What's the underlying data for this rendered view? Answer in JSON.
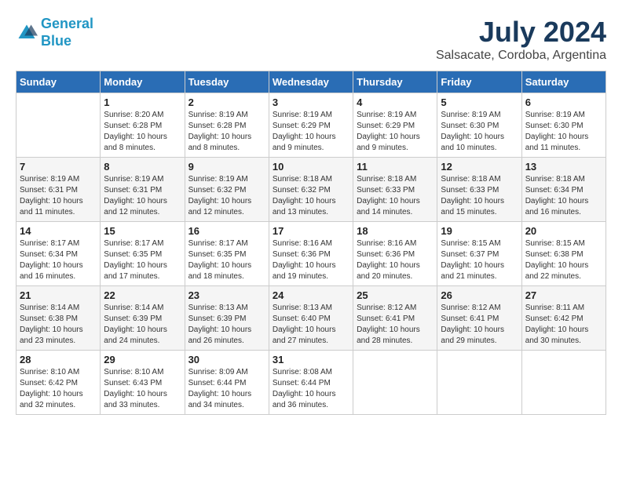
{
  "header": {
    "logo_line1": "General",
    "logo_line2": "Blue",
    "month_year": "July 2024",
    "location": "Salsacate, Cordoba, Argentina"
  },
  "weekdays": [
    "Sunday",
    "Monday",
    "Tuesday",
    "Wednesday",
    "Thursday",
    "Friday",
    "Saturday"
  ],
  "weeks": [
    [
      {
        "day": null,
        "info": null
      },
      {
        "day": "1",
        "info": "Sunrise: 8:20 AM\nSunset: 6:28 PM\nDaylight: 10 hours\nand 8 minutes."
      },
      {
        "day": "2",
        "info": "Sunrise: 8:19 AM\nSunset: 6:28 PM\nDaylight: 10 hours\nand 8 minutes."
      },
      {
        "day": "3",
        "info": "Sunrise: 8:19 AM\nSunset: 6:29 PM\nDaylight: 10 hours\nand 9 minutes."
      },
      {
        "day": "4",
        "info": "Sunrise: 8:19 AM\nSunset: 6:29 PM\nDaylight: 10 hours\nand 9 minutes."
      },
      {
        "day": "5",
        "info": "Sunrise: 8:19 AM\nSunset: 6:30 PM\nDaylight: 10 hours\nand 10 minutes."
      },
      {
        "day": "6",
        "info": "Sunrise: 8:19 AM\nSunset: 6:30 PM\nDaylight: 10 hours\nand 11 minutes."
      }
    ],
    [
      {
        "day": "7",
        "info": "Sunrise: 8:19 AM\nSunset: 6:31 PM\nDaylight: 10 hours\nand 11 minutes."
      },
      {
        "day": "8",
        "info": "Sunrise: 8:19 AM\nSunset: 6:31 PM\nDaylight: 10 hours\nand 12 minutes."
      },
      {
        "day": "9",
        "info": "Sunrise: 8:19 AM\nSunset: 6:32 PM\nDaylight: 10 hours\nand 12 minutes."
      },
      {
        "day": "10",
        "info": "Sunrise: 8:18 AM\nSunset: 6:32 PM\nDaylight: 10 hours\nand 13 minutes."
      },
      {
        "day": "11",
        "info": "Sunrise: 8:18 AM\nSunset: 6:33 PM\nDaylight: 10 hours\nand 14 minutes."
      },
      {
        "day": "12",
        "info": "Sunrise: 8:18 AM\nSunset: 6:33 PM\nDaylight: 10 hours\nand 15 minutes."
      },
      {
        "day": "13",
        "info": "Sunrise: 8:18 AM\nSunset: 6:34 PM\nDaylight: 10 hours\nand 16 minutes."
      }
    ],
    [
      {
        "day": "14",
        "info": "Sunrise: 8:17 AM\nSunset: 6:34 PM\nDaylight: 10 hours\nand 16 minutes."
      },
      {
        "day": "15",
        "info": "Sunrise: 8:17 AM\nSunset: 6:35 PM\nDaylight: 10 hours\nand 17 minutes."
      },
      {
        "day": "16",
        "info": "Sunrise: 8:17 AM\nSunset: 6:35 PM\nDaylight: 10 hours\nand 18 minutes."
      },
      {
        "day": "17",
        "info": "Sunrise: 8:16 AM\nSunset: 6:36 PM\nDaylight: 10 hours\nand 19 minutes."
      },
      {
        "day": "18",
        "info": "Sunrise: 8:16 AM\nSunset: 6:36 PM\nDaylight: 10 hours\nand 20 minutes."
      },
      {
        "day": "19",
        "info": "Sunrise: 8:15 AM\nSunset: 6:37 PM\nDaylight: 10 hours\nand 21 minutes."
      },
      {
        "day": "20",
        "info": "Sunrise: 8:15 AM\nSunset: 6:38 PM\nDaylight: 10 hours\nand 22 minutes."
      }
    ],
    [
      {
        "day": "21",
        "info": "Sunrise: 8:14 AM\nSunset: 6:38 PM\nDaylight: 10 hours\nand 23 minutes."
      },
      {
        "day": "22",
        "info": "Sunrise: 8:14 AM\nSunset: 6:39 PM\nDaylight: 10 hours\nand 24 minutes."
      },
      {
        "day": "23",
        "info": "Sunrise: 8:13 AM\nSunset: 6:39 PM\nDaylight: 10 hours\nand 26 minutes."
      },
      {
        "day": "24",
        "info": "Sunrise: 8:13 AM\nSunset: 6:40 PM\nDaylight: 10 hours\nand 27 minutes."
      },
      {
        "day": "25",
        "info": "Sunrise: 8:12 AM\nSunset: 6:41 PM\nDaylight: 10 hours\nand 28 minutes."
      },
      {
        "day": "26",
        "info": "Sunrise: 8:12 AM\nSunset: 6:41 PM\nDaylight: 10 hours\nand 29 minutes."
      },
      {
        "day": "27",
        "info": "Sunrise: 8:11 AM\nSunset: 6:42 PM\nDaylight: 10 hours\nand 30 minutes."
      }
    ],
    [
      {
        "day": "28",
        "info": "Sunrise: 8:10 AM\nSunset: 6:42 PM\nDaylight: 10 hours\nand 32 minutes."
      },
      {
        "day": "29",
        "info": "Sunrise: 8:10 AM\nSunset: 6:43 PM\nDaylight: 10 hours\nand 33 minutes."
      },
      {
        "day": "30",
        "info": "Sunrise: 8:09 AM\nSunset: 6:44 PM\nDaylight: 10 hours\nand 34 minutes."
      },
      {
        "day": "31",
        "info": "Sunrise: 8:08 AM\nSunset: 6:44 PM\nDaylight: 10 hours\nand 36 minutes."
      },
      {
        "day": null,
        "info": null
      },
      {
        "day": null,
        "info": null
      },
      {
        "day": null,
        "info": null
      }
    ]
  ]
}
